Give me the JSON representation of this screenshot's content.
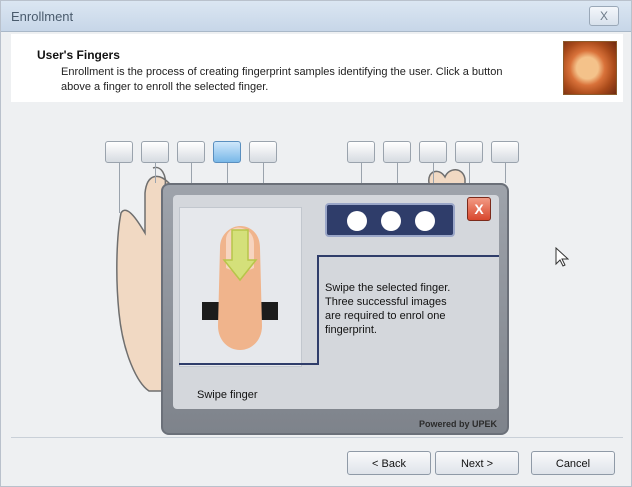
{
  "window": {
    "title": "Enrollment",
    "close_label": "X"
  },
  "header": {
    "title": "User's Fingers",
    "description": "Enrollment is the process of creating fingerprint samples identifying the user. Click a button above a finger to enroll the selected finger."
  },
  "finger_buttons": {
    "left_hand": [
      {
        "selected": false
      },
      {
        "selected": false
      },
      {
        "selected": false
      },
      {
        "selected": true
      },
      {
        "selected": false
      }
    ],
    "right_hand": [
      {
        "selected": false
      },
      {
        "selected": false
      },
      {
        "selected": false
      },
      {
        "selected": false
      },
      {
        "selected": false
      }
    ]
  },
  "dialog": {
    "message": "Swipe the selected finger. Three successful images are required to enrol one fingerprint.",
    "swipe_label": "Swipe finger",
    "powered_by": "Powered by UPEK",
    "close_label": "X",
    "progress_total": 3,
    "progress_complete": 0
  },
  "buttons": {
    "back": "< Back",
    "next": "Next >",
    "cancel": "Cancel"
  },
  "colors": {
    "progress_panel": "#2f3d6a",
    "close_red": "#d8472d",
    "selected_finger": "#79b8e8"
  },
  "icons": {
    "header": "fingerprint-hand-image",
    "dialog_close": "close-icon",
    "cursor": "mouse-pointer-icon"
  }
}
